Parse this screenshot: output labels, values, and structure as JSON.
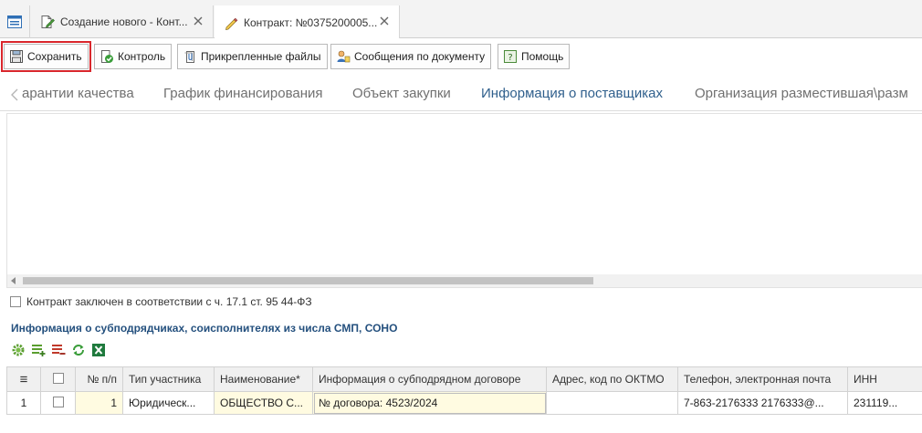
{
  "doc_tabs": [
    {
      "label": "Создание нового - Конт...",
      "active": false
    },
    {
      "label": "Контракт: №0375200005...",
      "active": true
    }
  ],
  "toolbar": {
    "save_label": "Сохранить",
    "control_label": "Контроль",
    "files_label": "Прикрепленные файлы",
    "messages_label": "Сообщения по документу",
    "help_label": "Помощь"
  },
  "section_tabs": [
    {
      "label": "арантии качества",
      "active": false
    },
    {
      "label": "График финансирования",
      "active": false
    },
    {
      "label": "Объект закупки",
      "active": false
    },
    {
      "label": "Информация о поставщиках",
      "active": true
    },
    {
      "label": "Организация разместившая\\разм",
      "active": false
    }
  ],
  "checkbox_label": "Контракт заключен в соответствии с ч. 17.1 ст. 95 44-ФЗ",
  "subcontractors": {
    "title": "Информация о субподрядчиках, соисполнителях из числа СМП, СОНО",
    "columns": [
      "≡",
      "",
      "№ п/п",
      "Тип участника",
      "Наименование*",
      "Информация о субподрядном договоре",
      "Адрес, код по ОКТМО",
      "Телефон, электронная почта",
      "ИНН"
    ],
    "rows": [
      {
        "row_index": "1",
        "num": "1",
        "type": "Юридическ...",
        "name": "ОБЩЕСТВО С...",
        "contract_info": "№ договора: 4523/2024",
        "address": "",
        "phone_email": "7-863-2176333 2176333@...",
        "inn": "231119..."
      }
    ]
  },
  "colors": {
    "accent": "#2f5f8c",
    "highlight": "#d9262c",
    "section_title": "#24507e",
    "cell_yellow": "#fffbe1"
  }
}
